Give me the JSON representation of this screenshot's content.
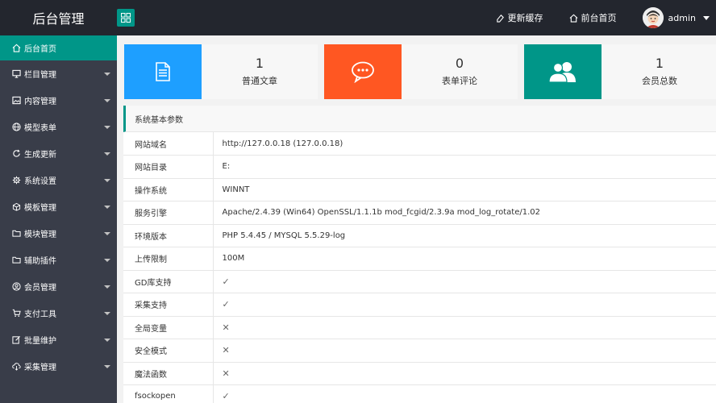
{
  "header": {
    "title": "后台管理",
    "links": [
      {
        "label": "更新缓存",
        "icon": "eraser-icon"
      },
      {
        "label": "前台首页",
        "icon": "home-icon"
      }
    ],
    "user": {
      "name": "admin"
    }
  },
  "sidebar": {
    "items": [
      {
        "label": "后台首页",
        "icon": "home-icon",
        "active": true
      },
      {
        "label": "栏目管理",
        "icon": "monitor-icon"
      },
      {
        "label": "内容管理",
        "icon": "picture-icon"
      },
      {
        "label": "模型表单",
        "icon": "globe-icon"
      },
      {
        "label": "生成更新",
        "icon": "refresh-icon"
      },
      {
        "label": "系统设置",
        "icon": "gear-icon"
      },
      {
        "label": "模板管理",
        "icon": "cube-icon"
      },
      {
        "label": "模块管理",
        "icon": "folder-icon"
      },
      {
        "label": "辅助插件",
        "icon": "folder-icon"
      },
      {
        "label": "会员管理",
        "icon": "user-circle-icon"
      },
      {
        "label": "支付工具",
        "icon": "cart-icon"
      },
      {
        "label": "批量维护",
        "icon": "edit-icon"
      },
      {
        "label": "采集管理",
        "icon": "cloud-download-icon"
      }
    ]
  },
  "stats": [
    {
      "value": "1",
      "label": "普通文章",
      "color": "#1e9fff",
      "icon": "document-icon"
    },
    {
      "value": "0",
      "label": "表单评论",
      "color": "#ff5722",
      "icon": "chat-icon"
    },
    {
      "value": "1",
      "label": "会员总数",
      "color": "#009688",
      "icon": "users-icon"
    }
  ],
  "panel": {
    "title": "系统基本参数",
    "rows": [
      {
        "key": "网站域名",
        "value": "http://127.0.0.18 (127.0.0.18)"
      },
      {
        "key": "网站目录",
        "value": "E:"
      },
      {
        "key": "操作系统",
        "value": "WINNT"
      },
      {
        "key": "服务引擎",
        "value": "Apache/2.4.39 (Win64) OpenSSL/1.1.1b mod_fcgid/2.3.9a mod_log_rotate/1.02"
      },
      {
        "key": "环境版本",
        "value": "PHP 5.4.45 / MYSQL 5.5.29-log"
      },
      {
        "key": "上传限制",
        "value": "100M"
      },
      {
        "key": "GD库支持",
        "value": "✓"
      },
      {
        "key": "采集支持",
        "value": "✓"
      },
      {
        "key": "全局变量",
        "value": "✕"
      },
      {
        "key": "安全模式",
        "value": "✕"
      },
      {
        "key": "魔法函数",
        "value": "✕"
      },
      {
        "key": "fsockopen",
        "value": "✓"
      }
    ]
  },
  "colors": {
    "accent": "#009688",
    "header": "#23262e",
    "sidebar": "#393d49"
  }
}
